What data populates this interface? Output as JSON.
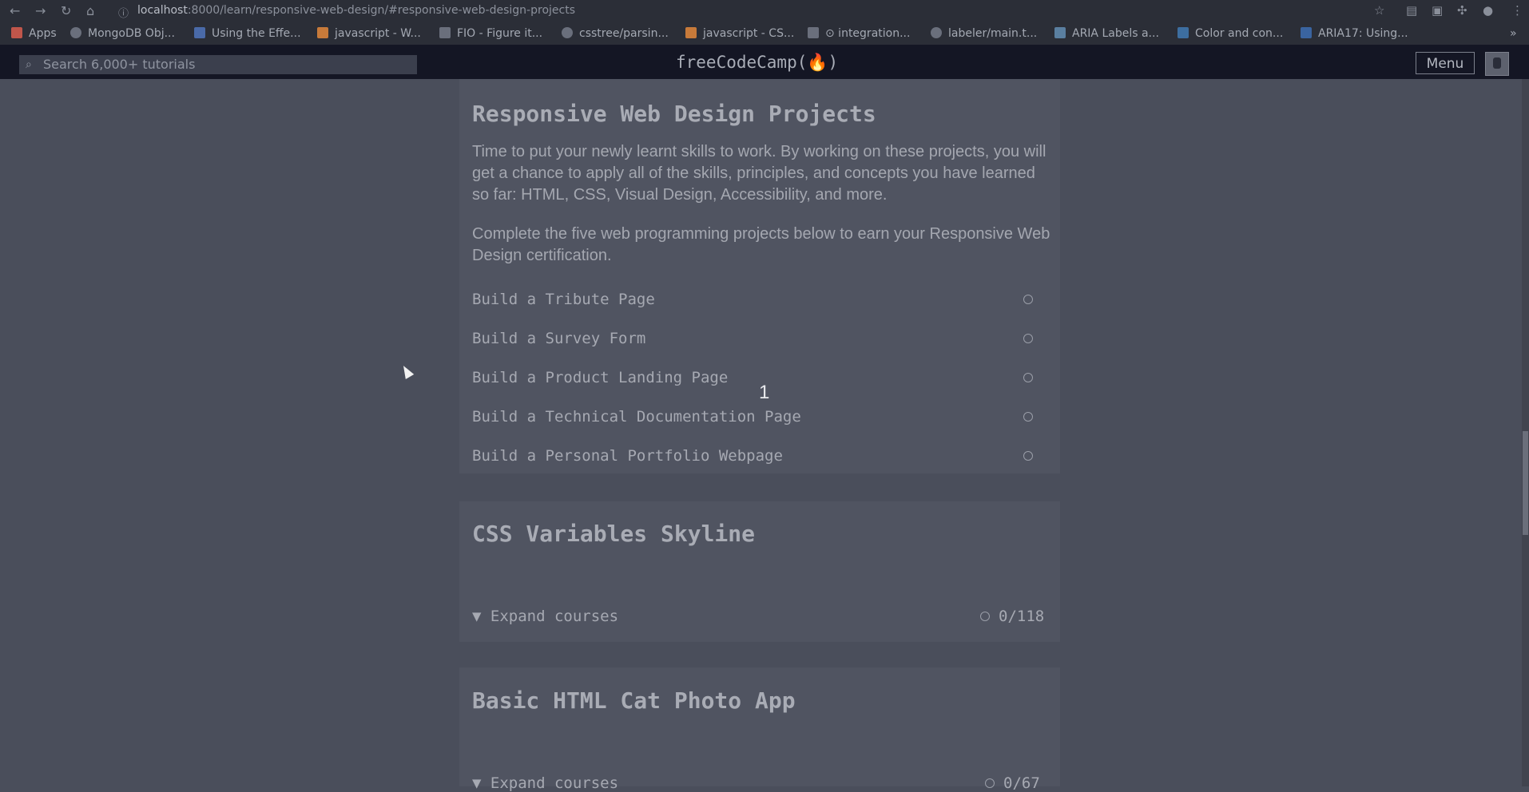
{
  "browser": {
    "url_host": "localhost",
    "url_path": ":8000/learn/responsive-web-design/#responsive-web-design-projects",
    "bookmarks": [
      {
        "label": "Apps",
        "icon": "apps-grid-icon"
      },
      {
        "label": "MongoDB Obj...",
        "icon": "mongodb-icon"
      },
      {
        "label": "Using the Effe...",
        "icon": "page-icon"
      },
      {
        "label": "javascript - W...",
        "icon": "stackoverflow-icon"
      },
      {
        "label": "FIO - Figure it...",
        "icon": "fio-icon"
      },
      {
        "label": "csstree/parsin...",
        "icon": "github-icon"
      },
      {
        "label": "javascript - CS...",
        "icon": "stackoverflow-icon"
      },
      {
        "label": "⊙ integration...",
        "icon": "page-icon"
      },
      {
        "label": "labeler/main.t...",
        "icon": "github-icon"
      },
      {
        "label": "ARIA Labels a...",
        "icon": "code-icon"
      },
      {
        "label": "Color and con...",
        "icon": "terminal-icon"
      },
      {
        "label": "ARIA17: Using...",
        "icon": "w3c-icon"
      }
    ]
  },
  "navbar": {
    "search_placeholder": "Search 6,000+ tutorials",
    "logo": "freeCodeCamp(🔥)",
    "menu_label": "Menu"
  },
  "projects_block": {
    "title": "Responsive Web Design Projects",
    "intro": "Time to put your newly learnt skills to work. By working on these projects, you will get a chance to apply all of the skills, principles, and concepts you have learned so far: HTML, CSS, Visual Design, Accessibility, and more.",
    "instructions": "Complete the five web programming projects below to earn your Responsive Web Design certification.",
    "projects": [
      "Build a Tribute Page",
      "Build a Survey Form",
      "Build a Product Landing Page",
      "Build a Technical Documentation Page",
      "Build a Personal Portfolio Webpage"
    ]
  },
  "blocks": [
    {
      "title": "CSS Variables Skyline",
      "expand_label": "▼ Expand courses",
      "progress": "0/118"
    },
    {
      "title": "Basic HTML Cat Photo App",
      "expand_label": "▼ Expand courses",
      "progress": "0/67"
    }
  ],
  "overlay_badge": "1"
}
